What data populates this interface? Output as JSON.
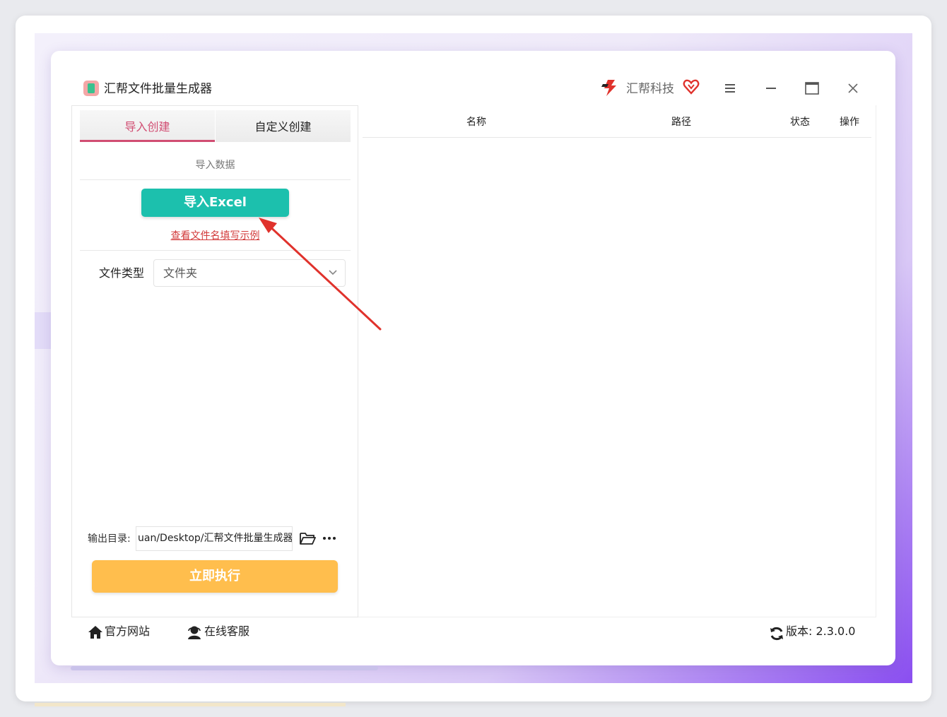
{
  "app": {
    "title": "汇帮文件批量生成器",
    "brand_name": "汇帮科技"
  },
  "tabs": [
    {
      "label": "导入创建",
      "active": true
    },
    {
      "label": "自定义创建",
      "active": false
    }
  ],
  "import_section": {
    "title": "导入数据",
    "import_button": "导入Excel",
    "example_link": "查看文件名填写示例"
  },
  "file_type": {
    "label": "文件类型",
    "selected": "文件夹"
  },
  "output": {
    "label": "输出目录:",
    "path": "uan/Desktop/汇帮文件批量生成器"
  },
  "run_button": "立即执行",
  "table": {
    "columns": [
      "名称",
      "路径",
      "状态",
      "操作"
    ],
    "rows": []
  },
  "footer": {
    "website": "官方网站",
    "support": "在线客服",
    "version_label": "版本:",
    "version": "2.3.0.0"
  },
  "colors": {
    "accent": "#d14d72",
    "import_button": "#1cc0ad",
    "run_button": "#ffbe4d",
    "link": "#d23a3a",
    "arrow": "#e0322c"
  },
  "icons": [
    "app-logo-icon",
    "brand-logo-icon",
    "vip-heart-icon",
    "menu-icon",
    "minimize-icon",
    "maximize-icon",
    "close-icon",
    "chevron-down-icon",
    "folder-icon",
    "more-icon",
    "home-icon",
    "support-icon",
    "refresh-icon"
  ]
}
